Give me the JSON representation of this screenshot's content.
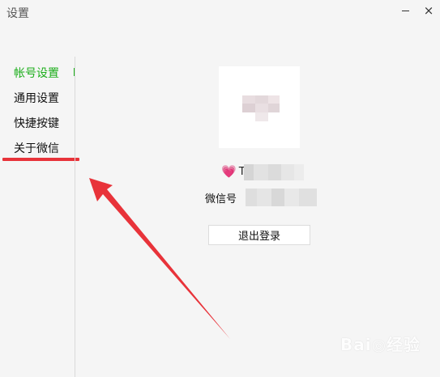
{
  "window": {
    "title": "设置",
    "minimize_icon": "minimize-icon",
    "close_icon": "close-icon",
    "close_glyph": "×"
  },
  "sidebar": {
    "items": [
      {
        "label": "帐号设置",
        "active": true
      },
      {
        "label": "通用设置",
        "active": false
      },
      {
        "label": "快捷按键",
        "active": false
      },
      {
        "label": "关于微信",
        "active": false
      }
    ]
  },
  "account": {
    "avatar": "avatar-image-blurred",
    "nickname_prefix_icon": "heart-emoji-icon",
    "nickname_initial": "T",
    "wechat_id_label": "微信号",
    "logout_label": "退出登录"
  },
  "annotation": {
    "arrow_color": "#e8333a",
    "underline_color": "#e8333a"
  },
  "watermark": {
    "text": "Bai◎经验"
  },
  "colors": {
    "active_nav": "#1aad19",
    "background": "#f5f5f5"
  }
}
